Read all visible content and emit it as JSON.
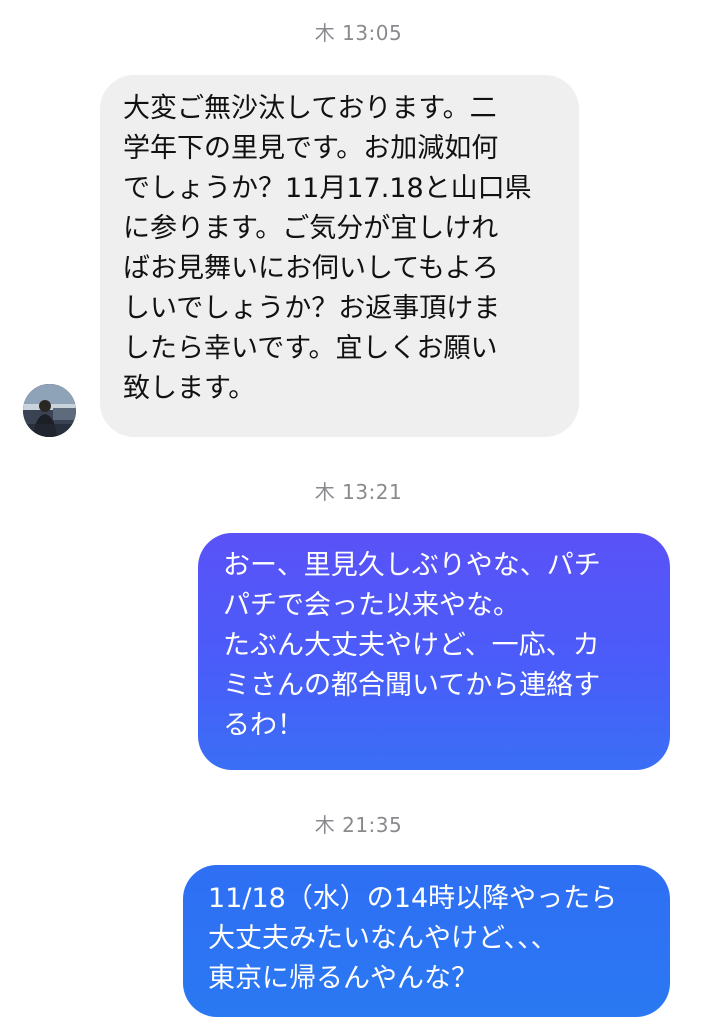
{
  "chat": {
    "messages": [
      {
        "timestamp": "木 13:05"
      },
      {
        "timestamp": "木 13:21"
      },
      {
        "timestamp": "木 21:35"
      }
    ],
    "incoming": {
      "text": "大変ご無沙汰しております。二\n学年下の里見です。お加減如何\nでしょうか？11月17.18と山口県\nに参ります。ご気分が宜しけれ\nばお見舞いにお伺いしてもよろ\nしいでしょうか？お返事頂けま\nしたら幸いです。宜しくお願い\n致します。",
      "avatar_icon": "contact-avatar-photo"
    },
    "outgoing": [
      {
        "text": "おー、里見久しぶりやな、パチ\nパチで会った以来やな。\nたぶん大丈夫やけど、一応、カ\nミさんの都合聞いてから連絡す\nるわ！"
      },
      {
        "text": "11/18（水）の14時以降やったら\n大丈夫みたいなんやけど、、、\n東京に帰るんやんな？"
      }
    ],
    "colors": {
      "incoming_bubble": "#efefef",
      "outgoing_bubble_top": "#5a52f7",
      "outgoing_bubble_bottom": "#2a78f2",
      "timestamp": "#8a8a8e"
    }
  }
}
